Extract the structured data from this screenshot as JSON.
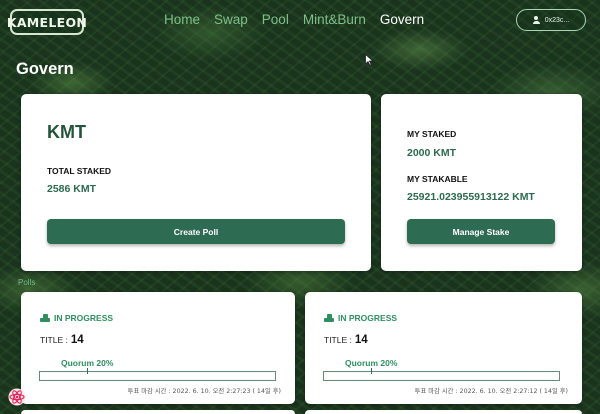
{
  "header": {
    "logo_text": "KAMELEON",
    "nav": [
      "Home",
      "Swap",
      "Pool",
      "Mint&Burn",
      "Govern"
    ],
    "active_nav": "Govern",
    "wallet_address": "0x23c..."
  },
  "page": {
    "title": "Govern"
  },
  "token_card": {
    "token": "KMT",
    "total_staked_label": "TOTAL STAKED",
    "total_staked_value": "2586 KMT",
    "create_poll_label": "Create Poll"
  },
  "my_card": {
    "my_staked_label": "MY STAKED",
    "my_staked_value": "2000 KMT",
    "my_stakable_label": "MY STAKABLE",
    "my_stakable_value": "25921.023955913122 KMT",
    "manage_stake_label": "Manage Stake"
  },
  "polls_label": "Polls",
  "polls": [
    {
      "status": "IN PROGRESS",
      "title_label": "TITLE :",
      "title_value": "14",
      "quorum_label": "Quorum 20%",
      "quorum_fraction": 0.2,
      "deadline": "투표 마감 시간 : 2022. 6. 10. 오전 2:27:23 ( 14일 후)"
    },
    {
      "status": "IN PROGRESS",
      "title_label": "TITLE :",
      "title_value": "14",
      "quorum_label": "Quorum 20%",
      "quorum_fraction": 0.2,
      "deadline": "투표 마감 시간 : 2022. 6. 10. 오전 2:27:12 ( 14일 후)"
    }
  ],
  "colors": {
    "accent": "#2e6b53",
    "value_text": "#2d6a4f",
    "status_green": "#2f8f60"
  }
}
